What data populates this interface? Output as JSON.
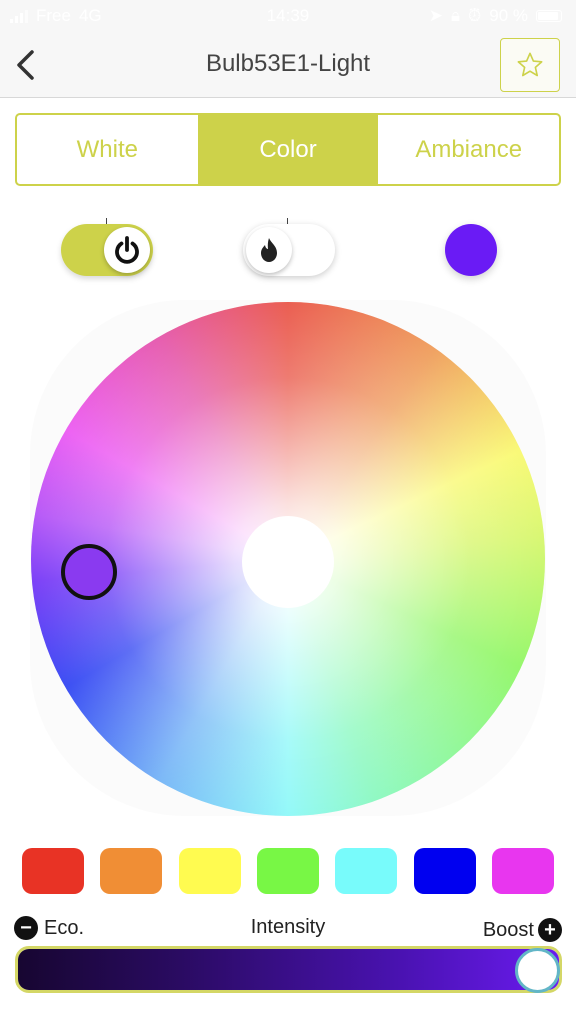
{
  "status_bar": {
    "carrier": "Free",
    "network": "4G",
    "time": "14:39",
    "battery": "90 %",
    "icons": [
      "signal-icon",
      "location-icon",
      "lock-rotation-icon",
      "alarm-icon",
      "battery-icon"
    ]
  },
  "header": {
    "title": "Bulb53E1-Light",
    "back_icon": "chevron-left-icon",
    "favorite_icon": "star-outline-icon"
  },
  "tabs": [
    {
      "label": "White",
      "active": false
    },
    {
      "label": "Color",
      "active": true
    },
    {
      "label": "Ambiance",
      "active": false
    }
  ],
  "controls": {
    "power_toggle": {
      "icon": "power-icon",
      "on": true
    },
    "effect_toggle": {
      "icon": "flame-icon",
      "on": false
    },
    "current_color": "#6a1bf5"
  },
  "color_wheel": {
    "selected_hue_deg": 265,
    "selected_color": "#8a3af0"
  },
  "swatches": [
    {
      "name": "red",
      "color": "#e83325"
    },
    {
      "name": "orange",
      "color": "#f08e35"
    },
    {
      "name": "yellow",
      "color": "#fffb50"
    },
    {
      "name": "green",
      "color": "#78f745"
    },
    {
      "name": "cyan",
      "color": "#78fbfb"
    },
    {
      "name": "blue",
      "color": "#0000f0"
    },
    {
      "name": "magenta",
      "color": "#e836ef"
    }
  ],
  "intensity": {
    "label": "Intensity",
    "min_label": "Eco.",
    "max_label": "Boost",
    "min_icon": "minus-circle-icon",
    "max_icon": "plus-circle-icon",
    "value_percent": 100
  },
  "colors": {
    "accent": "#cdd24a",
    "slider_border": "#d4d766",
    "thumb_border": "#62b6c7"
  }
}
